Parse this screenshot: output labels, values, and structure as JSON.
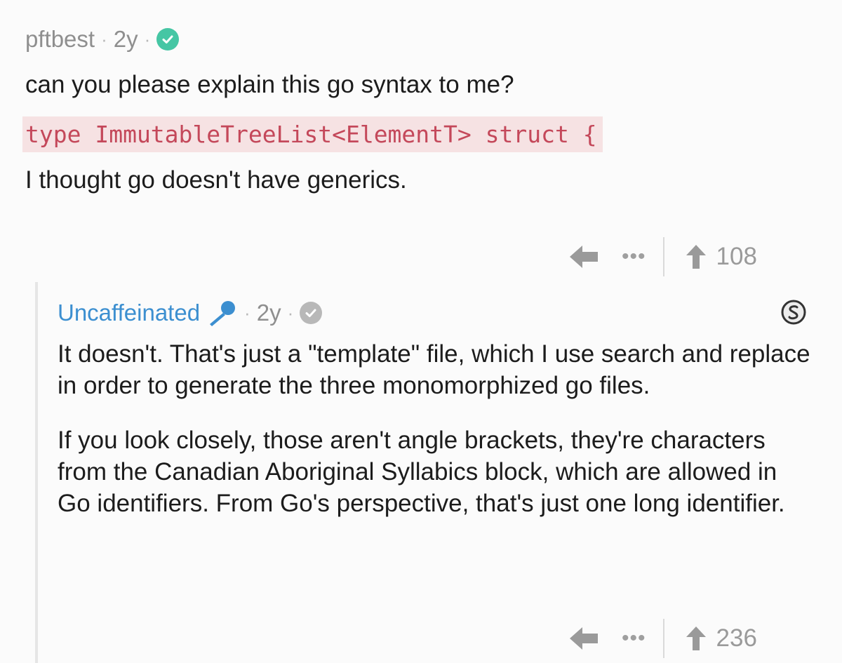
{
  "comment": {
    "author": "pftbest",
    "age": "2y",
    "text": "can you please explain this go syntax to me?",
    "code": "type ImmutableTreeList<ElementT> struct {",
    "text2": "I thought go doesn't have generics.",
    "score": "108",
    "more": "•••"
  },
  "reply": {
    "author": "Uncaffeinated",
    "age": "2y",
    "paragraph1": "It doesn't. That's just a \"template\" file, which I use search and replace in order to generate the three monomorphized go files.",
    "paragraph2": "If you look closely, those aren't angle brackets, they're characters from the Canadian Aboriginal Syllabics block, which are allowed in Go identifiers. From Go's perspective, that's just one long identifier.",
    "score": "236",
    "more": "•••"
  },
  "colors": {
    "background": "#fbfbfb",
    "check_op": "#46c6a4",
    "check_reply": "#b8b8b8",
    "reply_author": "#3c8fd0",
    "code_text": "#c4485a",
    "code_bg": "#f6e2e3"
  },
  "icons": [
    "verified-check-icon",
    "reply-arrow-icon",
    "upvote-arrow-icon",
    "microphone-flair-icon",
    "award-coin-icon"
  ]
}
